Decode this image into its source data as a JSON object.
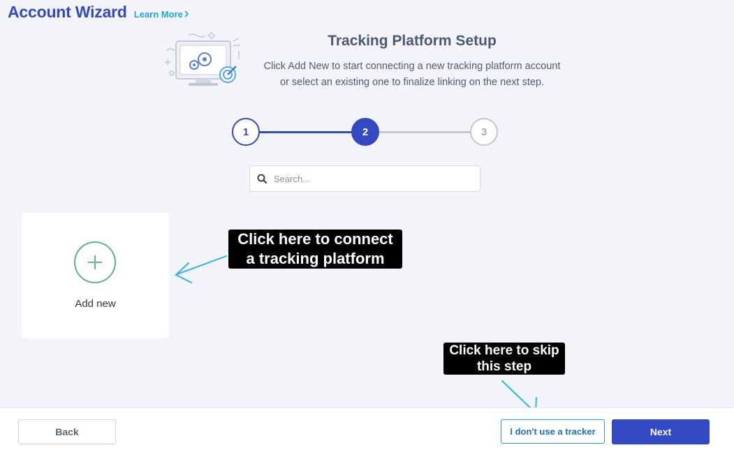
{
  "header": {
    "title": "Account Wizard",
    "learn_more": "Learn More",
    "learn_more_icon": "chevron-right-icon"
  },
  "setup": {
    "title": "Tracking Platform Setup",
    "description_line1": "Click Add New to start connecting a new tracking platform account",
    "description_line2": "or select an existing one to finalize linking on the next step."
  },
  "stepper": {
    "steps": [
      {
        "label": "1",
        "state": "complete"
      },
      {
        "label": "2",
        "state": "active"
      },
      {
        "label": "3",
        "state": "pending"
      }
    ]
  },
  "search": {
    "placeholder": "Search...",
    "value": ""
  },
  "add_card": {
    "label": "Add new",
    "icon": "plus-icon"
  },
  "callouts": {
    "connect_line1": "Click here to connect",
    "connect_line2": "a tracking platform",
    "skip_line1": "Click here to skip",
    "skip_line2": "this step"
  },
  "footer": {
    "back": "Back",
    "no_tracker": "I don't use a tracker",
    "next": "Next"
  },
  "colors": {
    "brand": "#3249c2",
    "accent": "#1fa3e0",
    "add_green": "#5fb48b",
    "annotation_arrow": "#29b6e8"
  }
}
